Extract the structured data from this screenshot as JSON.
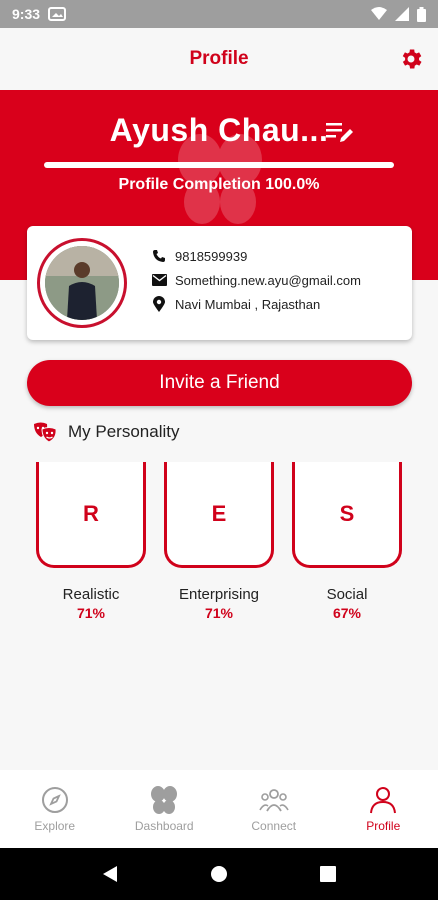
{
  "status_bar": {
    "time": "9:33"
  },
  "app_bar": {
    "title": "Profile"
  },
  "hero": {
    "name": "Ayush Chau...",
    "completion_text": "Profile Completion 100.0%",
    "completion_fraction": 1.0
  },
  "profile": {
    "phone": "9818599939",
    "email": "Something.new.ayu@gmail.com",
    "location": "Navi Mumbai , Rajasthan"
  },
  "invite_label": "Invite a Friend",
  "personality": {
    "heading": "My Personality",
    "traits": [
      {
        "letter": "R",
        "name": "Realistic",
        "percent": "71%"
      },
      {
        "letter": "E",
        "name": "Enterprising",
        "percent": "71%"
      },
      {
        "letter": "S",
        "name": "Social",
        "percent": "67%"
      }
    ]
  },
  "bottom_nav": {
    "items": [
      {
        "label": "Explore",
        "icon": "compass-icon",
        "active": false
      },
      {
        "label": "Dashboard",
        "icon": "butterfly-icon",
        "active": false
      },
      {
        "label": "Connect",
        "icon": "people-icon",
        "active": false
      },
      {
        "label": "Profile",
        "icon": "person-icon",
        "active": true
      }
    ]
  },
  "colors": {
    "brand_red": "#d9001b",
    "accent_red": "#d0021b",
    "inactive_gray": "#9e9e9e"
  }
}
